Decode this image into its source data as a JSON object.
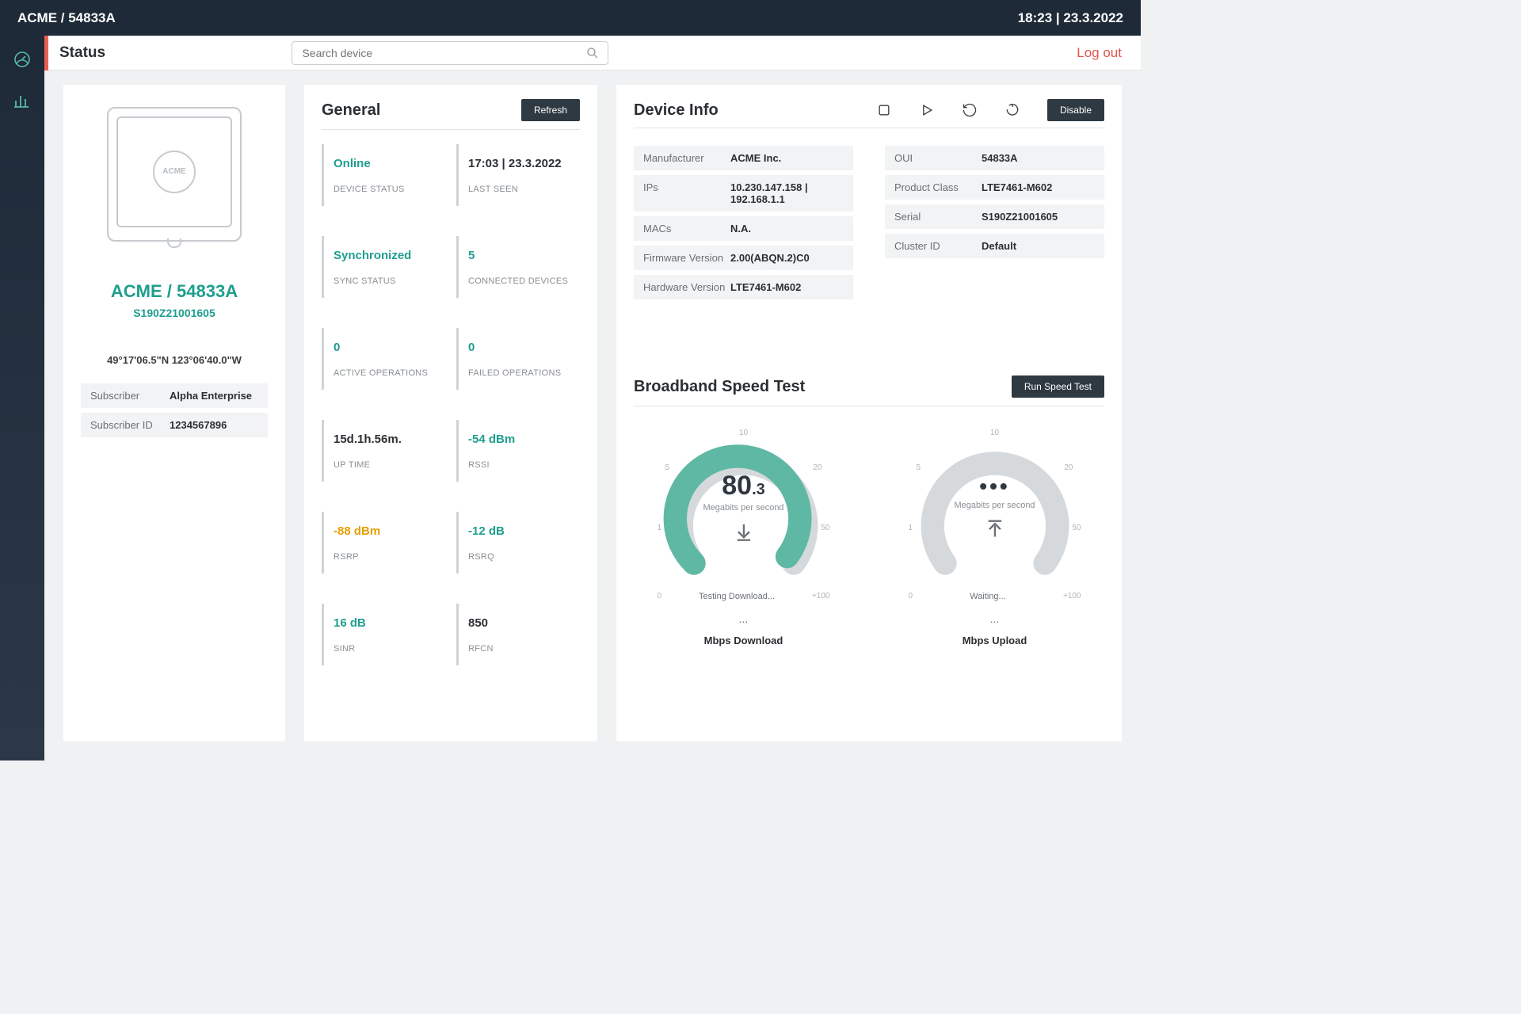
{
  "topbar": {
    "breadcrumb": "ACME / 54833A",
    "clock": "18:23 | 23.3.2022"
  },
  "header": {
    "title": "Status",
    "search_placeholder": "Search device",
    "logout": "Log out"
  },
  "left_panel": {
    "image_brand": "ACME",
    "title": "ACME / 54833A",
    "serial": "S190Z21001605",
    "coords": "49°17'06.5\"N 123°06'40.0\"W",
    "subscriber_label": "Subscriber",
    "subscriber": "Alpha Enterprise",
    "subscriber_id_label": "Subscriber ID",
    "subscriber_id": "1234567896"
  },
  "general": {
    "title": "General",
    "refresh": "Refresh",
    "stats": [
      {
        "val": "Online",
        "lbl": "DEVICE STATUS",
        "color": "teal"
      },
      {
        "val": "17:03 | 23.3.2022",
        "lbl": "LAST SEEN",
        "color": "dark"
      },
      {
        "val": "Synchronized",
        "lbl": "SYNC STATUS",
        "color": "teal"
      },
      {
        "val": "5",
        "lbl": "CONNECTED DEVICES",
        "color": "teal"
      },
      {
        "val": "0",
        "lbl": "ACTIVE OPERATIONS",
        "color": "teal"
      },
      {
        "val": "0",
        "lbl": "FAILED OPERATIONS",
        "color": "teal"
      },
      {
        "val": "15d.1h.56m.",
        "lbl": "UP TIME",
        "color": "dark"
      },
      {
        "val": "-54 dBm",
        "lbl": "RSSI",
        "color": "teal"
      },
      {
        "val": "-88 dBm",
        "lbl": "RSRP",
        "color": "amber"
      },
      {
        "val": "-12 dB",
        "lbl": "RSRQ",
        "color": "teal"
      },
      {
        "val": "16 dB",
        "lbl": "SINR",
        "color": "teal"
      },
      {
        "val": "850",
        "lbl": "RFCN",
        "color": "dark"
      }
    ]
  },
  "device_info": {
    "title": "Device Info",
    "disable": "Disable",
    "left": [
      {
        "k": "Manufacturer",
        "v": "ACME Inc."
      },
      {
        "k": "IPs",
        "v": "10.230.147.158 | 192.168.1.1"
      },
      {
        "k": "MACs",
        "v": "N.A."
      },
      {
        "k": "Firmware Version",
        "v": "2.00(ABQN.2)C0"
      },
      {
        "k": "Hardware Version",
        "v": "LTE7461-M602"
      }
    ],
    "right": [
      {
        "k": "OUI",
        "v": "54833A"
      },
      {
        "k": "Product Class",
        "v": "LTE7461-M602"
      },
      {
        "k": "Serial",
        "v": "S190Z21001605"
      },
      {
        "k": "Cluster ID",
        "v": "Default"
      }
    ]
  },
  "speed": {
    "title": "Broadband Speed Test",
    "run": "Run Speed Test",
    "ticks": {
      "top": "10",
      "tl": "5",
      "tr": "20",
      "l": "1",
      "r": "50",
      "bl": "0",
      "br": "+100"
    },
    "download": {
      "value_major": "80",
      "value_minor": ".3",
      "unit": "Megabits per second",
      "status": "Testing Download...",
      "ellipsis": "...",
      "foot": "Mbps Download"
    },
    "upload": {
      "dots": "•••",
      "unit": "Megabits per second",
      "status": "Waiting...",
      "ellipsis": "...",
      "foot": "Mbps Upload"
    }
  }
}
